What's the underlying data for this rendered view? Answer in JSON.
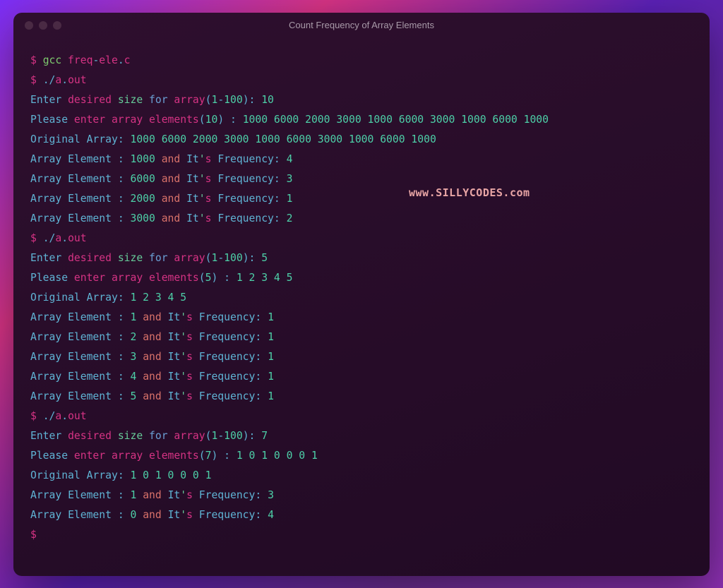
{
  "window": {
    "title": "Count Frequency of Array Elements"
  },
  "watermark": "www.SILLYCODES.com",
  "prompt": "$",
  "cmd": {
    "compile": "gcc freq-ele.c",
    "run": "./a.out"
  },
  "text": {
    "gcc": "gcc",
    "freq": " freq",
    "dash": "-",
    "ele": "ele",
    "dot": ".",
    "c": "c",
    "dotslash": "./",
    "a": "a",
    "out": "out",
    "enter": "Enter",
    "desired": "desired",
    "size": "size",
    "for": "for",
    "array": "array",
    "lparen": "(",
    "one": "1",
    "hundred": "100",
    "rparen": ")",
    "colon": ":",
    "please": "Please",
    "enter2": "enter",
    "elements": "elements",
    "original": "Original",
    "arrayLabel": "Array",
    "element": "Element",
    "and": "and",
    "it": "It",
    "apos": "'",
    "s": "s",
    "frequency": "Frequency"
  },
  "runs": [
    {
      "size": "10",
      "input": "1000 6000 2000 3000 1000 6000 3000 1000 6000 1000",
      "original": "1000 6000 2000 3000 1000 6000 3000 1000 6000 1000",
      "freq": [
        {
          "elem": "1000",
          "count": "4"
        },
        {
          "elem": "6000",
          "count": "3"
        },
        {
          "elem": "2000",
          "count": "1"
        },
        {
          "elem": "3000",
          "count": "2"
        }
      ]
    },
    {
      "size": "5",
      "input": "1 2 3 4 5",
      "original": "1 2 3 4 5",
      "freq": [
        {
          "elem": "1",
          "count": "1"
        },
        {
          "elem": "2",
          "count": "1"
        },
        {
          "elem": "3",
          "count": "1"
        },
        {
          "elem": "4",
          "count": "1"
        },
        {
          "elem": "5",
          "count": "1"
        }
      ]
    },
    {
      "size": "7",
      "input": "1 0 1 0 0 0 1",
      "original": "1 0 1 0 0 0 1",
      "freq": [
        {
          "elem": "1",
          "count": "3"
        },
        {
          "elem": "0",
          "count": "4"
        }
      ]
    }
  ]
}
